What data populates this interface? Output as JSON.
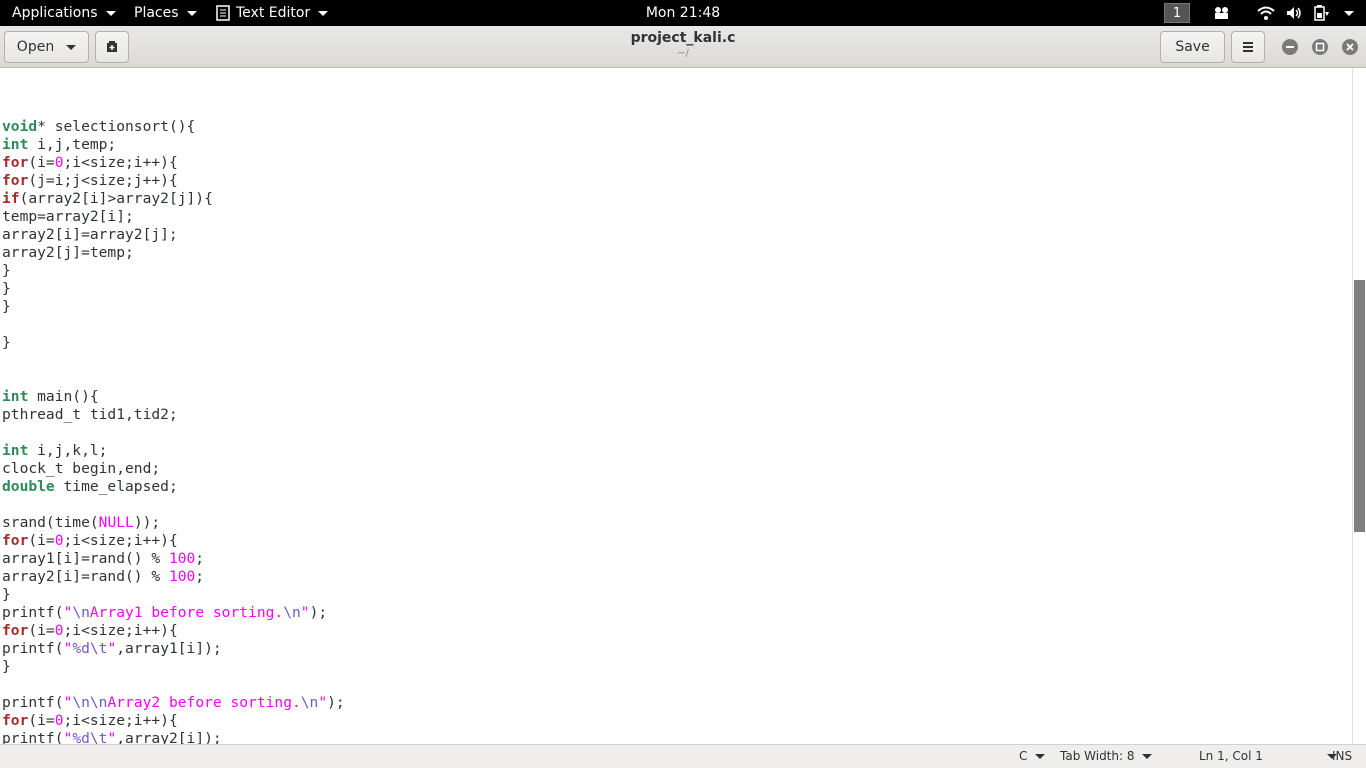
{
  "top_panel": {
    "applications": "Applications",
    "places": "Places",
    "app_name": "Text Editor",
    "clock": "Mon 21:48",
    "workspace": "1"
  },
  "header": {
    "open_label": "Open",
    "title": "project_kali.c",
    "subtitle": "~/",
    "save_label": "Save"
  },
  "code_lines": [
    [],
    [
      {
        "t": "void",
        "c": "ty"
      },
      {
        "t": "* selectionsort(){",
        "c": ""
      }
    ],
    [
      {
        "t": "int",
        "c": "ty"
      },
      {
        "t": " i,j,temp;",
        "c": ""
      }
    ],
    [
      {
        "t": "for",
        "c": "kw"
      },
      {
        "t": "(i=",
        "c": ""
      },
      {
        "t": "0",
        "c": "num"
      },
      {
        "t": ";i<size;i++){",
        "c": ""
      }
    ],
    [
      {
        "t": "for",
        "c": "kw"
      },
      {
        "t": "(j=i;j<size;j++){",
        "c": ""
      }
    ],
    [
      {
        "t": "if",
        "c": "kw"
      },
      {
        "t": "(array2[i]>array2[j]){",
        "c": ""
      }
    ],
    [
      {
        "t": "temp=array2[i];",
        "c": ""
      }
    ],
    [
      {
        "t": "array2[i]=array2[j];",
        "c": ""
      }
    ],
    [
      {
        "t": "array2[j]=temp;",
        "c": ""
      }
    ],
    [
      {
        "t": "}",
        "c": ""
      }
    ],
    [
      {
        "t": "}",
        "c": ""
      }
    ],
    [
      {
        "t": "}",
        "c": ""
      }
    ],
    [],
    [
      {
        "t": "}",
        "c": ""
      }
    ],
    [],
    [],
    [
      {
        "t": "int",
        "c": "ty"
      },
      {
        "t": " main(){",
        "c": ""
      }
    ],
    [
      {
        "t": "pthread_t tid1,tid2;",
        "c": ""
      }
    ],
    [],
    [
      {
        "t": "int",
        "c": "ty"
      },
      {
        "t": " i,j,k,l;",
        "c": ""
      }
    ],
    [
      {
        "t": "clock_t begin,end;",
        "c": ""
      }
    ],
    [
      {
        "t": "double",
        "c": "ty"
      },
      {
        "t": " time_elapsed;",
        "c": ""
      }
    ],
    [],
    [
      {
        "t": "srand(time(",
        "c": ""
      },
      {
        "t": "NULL",
        "c": "num"
      },
      {
        "t": "));",
        "c": ""
      }
    ],
    [
      {
        "t": "for",
        "c": "kw"
      },
      {
        "t": "(i=",
        "c": ""
      },
      {
        "t": "0",
        "c": "num"
      },
      {
        "t": ";i<size;i++){",
        "c": ""
      }
    ],
    [
      {
        "t": "array1[i]=rand() % ",
        "c": ""
      },
      {
        "t": "100",
        "c": "num"
      },
      {
        "t": ";",
        "c": ""
      }
    ],
    [
      {
        "t": "array2[i]=rand() % ",
        "c": ""
      },
      {
        "t": "100",
        "c": "num"
      },
      {
        "t": ";",
        "c": ""
      }
    ],
    [
      {
        "t": "}",
        "c": ""
      }
    ],
    [
      {
        "t": "printf(",
        "c": ""
      },
      {
        "t": "\"",
        "c": "str"
      },
      {
        "t": "\\n",
        "c": "esc"
      },
      {
        "t": "Array1 before sorting.",
        "c": "str"
      },
      {
        "t": "\\n",
        "c": "esc"
      },
      {
        "t": "\"",
        "c": "str"
      },
      {
        "t": ");",
        "c": ""
      }
    ],
    [
      {
        "t": "for",
        "c": "kw"
      },
      {
        "t": "(i=",
        "c": ""
      },
      {
        "t": "0",
        "c": "num"
      },
      {
        "t": ";i<size;i++){",
        "c": ""
      }
    ],
    [
      {
        "t": "printf(",
        "c": ""
      },
      {
        "t": "\"",
        "c": "str"
      },
      {
        "t": "%d",
        "c": "esc"
      },
      {
        "t": "\\t",
        "c": "esc"
      },
      {
        "t": "\"",
        "c": "str"
      },
      {
        "t": ",array1[i]);",
        "c": ""
      }
    ],
    [
      {
        "t": "}",
        "c": ""
      }
    ],
    [],
    [
      {
        "t": "printf(",
        "c": ""
      },
      {
        "t": "\"",
        "c": "str"
      },
      {
        "t": "\\n\\n",
        "c": "esc"
      },
      {
        "t": "Array2 before sorting.",
        "c": "str"
      },
      {
        "t": "\\n",
        "c": "esc"
      },
      {
        "t": "\"",
        "c": "str"
      },
      {
        "t": ");",
        "c": ""
      }
    ],
    [
      {
        "t": "for",
        "c": "kw"
      },
      {
        "t": "(i=",
        "c": ""
      },
      {
        "t": "0",
        "c": "num"
      },
      {
        "t": ";i<size;i++){",
        "c": ""
      }
    ],
    [
      {
        "t": "printf(",
        "c": ""
      },
      {
        "t": "\"",
        "c": "str"
      },
      {
        "t": "%d",
        "c": "esc"
      },
      {
        "t": "\\t",
        "c": "esc"
      },
      {
        "t": "\"",
        "c": "str"
      },
      {
        "t": ",array2[i]);",
        "c": ""
      }
    ],
    [
      {
        "t": "}",
        "c": ""
      }
    ]
  ],
  "status": {
    "language": "C",
    "tab_width": "Tab Width: 8",
    "position": "Ln 1, Col 1",
    "mode": "INS"
  },
  "colors": {
    "keyword": "#a52a2a",
    "type": "#2e8b57",
    "literal": "#ff00ff",
    "escape": "#6a5acd"
  },
  "icons": [
    "chevron-down-icon",
    "document-icon",
    "camera-icon",
    "wifi-icon",
    "volume-icon",
    "battery-icon",
    "new-document-icon",
    "hamburger-menu-icon",
    "minimize-icon",
    "maximize-icon",
    "close-icon"
  ]
}
